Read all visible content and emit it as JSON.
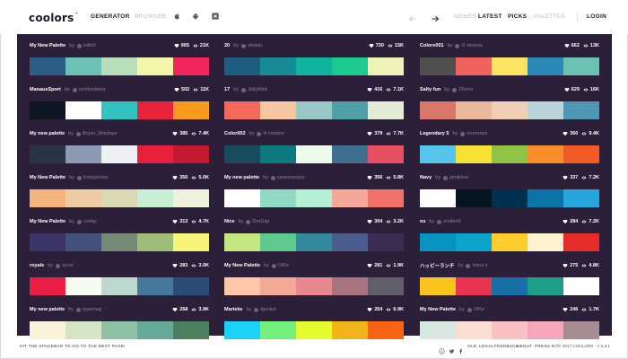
{
  "header": {
    "logo": "coolors",
    "nav": {
      "generator": "GENERATOR",
      "browser": "BROWSER",
      "newest": "NEWEST",
      "latest": "LATEST",
      "picks": "PICKS",
      "palettes": "PALETTES",
      "login": "LOGIN"
    },
    "icons": [
      "apple-icon",
      "android-icon",
      "adobe-icon",
      "arrow-left-icon",
      "arrow-right-icon"
    ]
  },
  "columns": [
    [
      {
        "name": "My New Palette",
        "by": "by",
        "user": "bdilch",
        "saves": "905",
        "views": "21K",
        "colors": [
          "#2a5d86",
          "#6cc2b4",
          "#b7ddb9",
          "#f3f6a8",
          "#f0265d"
        ]
      },
      {
        "name": "ManausSport",
        "by": "by",
        "user": "coolhodiana",
        "saves": "502",
        "views": "11K",
        "colors": [
          "#0f1722",
          "#ffffff",
          "#32c3bf",
          "#e8243d",
          "#f79b1c"
        ]
      },
      {
        "name": "My new palette",
        "by": "by",
        "user": "Bryen_Montoye",
        "saves": "385",
        "views": "7.4K",
        "colors": [
          "#293247",
          "#8d9ab3",
          "#eef0f4",
          "#e81f3a",
          "#c41a31"
        ]
      },
      {
        "name": "My New Palette",
        "by": "by",
        "user": "krispykriets",
        "saves": "356",
        "views": "5.0K",
        "colors": [
          "#f4b47d",
          "#eecca3",
          "#dbd8b5",
          "#c9edd5",
          "#eef2dd"
        ]
      },
      {
        "name": "My New Palette",
        "by": "by",
        "user": "coday",
        "saves": "313",
        "views": "4.7K",
        "colors": [
          "#3c3468",
          "#425179",
          "#758a74",
          "#9dbc77",
          "#f7f579"
        ]
      },
      {
        "name": "royale",
        "by": "by",
        "user": "sycol",
        "saves": "283",
        "views": "3.0K",
        "colors": [
          "#e81d43",
          "#f4fbef",
          "#bdd9cf",
          "#45789b",
          "#2c4c73"
        ]
      },
      {
        "name": "My new palette",
        "by": "by",
        "user": "typemag",
        "saves": "268",
        "views": "3.9K",
        "colors": [
          "#fbf3d9",
          "#d4e4c5",
          "#8fc1a6",
          "#66ab9a",
          "#4b7f5d"
        ]
      }
    ],
    [
      {
        "name": "20",
        "by": "by",
        "user": "stinkdc",
        "saves": "730",
        "views": "15K",
        "colors": [
          "#1f5d80",
          "#168a97",
          "#10b39e",
          "#1cca8f",
          "#ecf3b7"
        ]
      },
      {
        "name": "17",
        "by": "by",
        "user": "JollyMatt",
        "saves": "416",
        "views": "7.1K",
        "colors": [
          "#f36a5d",
          "#f6c6a2",
          "#99c8c5",
          "#4f9fa8",
          "#e3ecd4"
        ]
      },
      {
        "name": "Color002",
        "by": "by",
        "user": "lil nisslow",
        "saves": "379",
        "views": "7.7K",
        "colors": [
          "#194a5e",
          "#0d7a7d",
          "#eefbea",
          "#3f6e8e",
          "#e94f63"
        ]
      },
      {
        "name": "My new palette",
        "by": "by",
        "user": "vanessacpnr",
        "saves": "356",
        "views": "5.8K",
        "colors": [
          "#ffffff",
          "#8fd9c5",
          "#b4f0d3",
          "#f8a89a",
          "#f07167"
        ]
      },
      {
        "name": "Nice",
        "by": "by",
        "user": "DorGigi",
        "saves": "304",
        "views": "3.2K",
        "colors": [
          "#c3e77e",
          "#5ecb8e",
          "#348a9a",
          "#4c5c8d",
          "#3b2c54"
        ]
      },
      {
        "name": "My New Palette",
        "by": "by",
        "user": "Of6e",
        "saves": "281",
        "views": "1.9K",
        "colors": [
          "#fec7a9",
          "#f4a897",
          "#e8878d",
          "#a97380",
          "#605f68"
        ]
      },
      {
        "name": "Marieke",
        "by": "by",
        "user": "djenkel",
        "saves": "264",
        "views": "6.9K",
        "colors": [
          "#1bd1f5",
          "#74f07d",
          "#e6fb2b",
          "#f0b418",
          "#f86414"
        ]
      }
    ],
    [
      {
        "name": "Colors001",
        "by": "by",
        "user": "lil nisslow",
        "saves": "662",
        "views": "13K",
        "colors": [
          "#4f4f4f",
          "#f1625d",
          "#fce362",
          "#2a89b6",
          "#6cc2b2"
        ]
      },
      {
        "name": "Salty fun",
        "by": "by",
        "user": "Tilvero",
        "saves": "629",
        "views": "16K",
        "colors": [
          "#d9776a",
          "#e9b89d",
          "#f1ceb6",
          "#bad4d8",
          "#4f97b5"
        ]
      },
      {
        "name": "Legendary 5",
        "by": "by",
        "user": "morenam",
        "saves": "360",
        "views": "9.4K",
        "colors": [
          "#55c5ea",
          "#f7e137",
          "#91c345",
          "#f88d2a",
          "#f15a24"
        ]
      },
      {
        "name": "Navy",
        "by": "by",
        "user": "jamiklow",
        "saves": "337",
        "views": "7.2K",
        "colors": [
          "#ffffff",
          "#06151f",
          "#00324f",
          "#0b73a5",
          "#27a5dd"
        ]
      },
      {
        "name": "ns",
        "by": "by",
        "user": "zrelbnt6",
        "saves": "284",
        "views": "7.2K",
        "colors": [
          "#0593c2",
          "#0ba4cb",
          "#fecc2c",
          "#fef1d0",
          "#e52d2a"
        ]
      },
      {
        "name": "ハッピーランチ",
        "by": "by",
        "user": "mizur-r",
        "saves": "275",
        "views": "4.8K",
        "colors": [
          "#fac31c",
          "#e8344f",
          "#1a6fa7",
          "#1d9e8a",
          "#ffffff"
        ]
      },
      {
        "name": "My New Palette",
        "by": "by",
        "user": "Of6e",
        "saves": "246",
        "views": "1.7K",
        "colors": [
          "#d9e7e1",
          "#fcded3",
          "#fac1c5",
          "#f6a6bb",
          "#a88c94"
        ]
      }
    ]
  ],
  "footer": {
    "hint": "HIT THE SPACEBAR TO GO TO THE NEXT PAGE!",
    "links": [
      "OLD",
      "LEGAL",
      "FEEDBACK",
      "ABOUT",
      "PRESS KIT"
    ],
    "copyright": "© 2017 COOLORS · V 2.3.1"
  }
}
